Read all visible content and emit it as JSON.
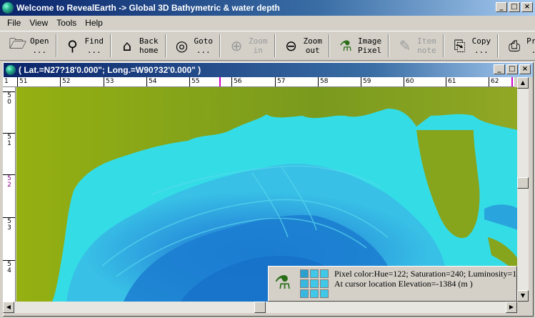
{
  "window": {
    "title": "Welcome to RevealEarth -> Global 3D Bathymetric &  water depth"
  },
  "menu": [
    "File",
    "View",
    "Tools",
    "Help"
  ],
  "toolbar": [
    {
      "icon": "open-icon",
      "label": "Open\n...",
      "enabled": true
    },
    {
      "icon": "binoculars-icon",
      "label": "Find\n...",
      "enabled": true
    },
    {
      "icon": "back-home-icon",
      "label": "Back\nhome",
      "enabled": true
    },
    {
      "icon": "compass-icon",
      "label": "Goto\n...",
      "enabled": true
    },
    {
      "icon": "zoom-in-icon",
      "label": "Zoom\nin",
      "enabled": false
    },
    {
      "icon": "zoom-out-icon",
      "label": "Zoom\nout",
      "enabled": true
    },
    {
      "icon": "microscope-icon",
      "label": "Image\nPixel",
      "enabled": true
    },
    {
      "icon": "item-note-icon",
      "label": "Item\nnote",
      "enabled": false
    },
    {
      "icon": "copy-icon",
      "label": "Copy\n...",
      "enabled": true
    },
    {
      "icon": "printer-icon",
      "label": "Print\n...",
      "enabled": true
    }
  ],
  "child_window": {
    "title": "( Lat.=N27?18'0.000\"; Long.=W90?32'0.000\" )"
  },
  "ruler_top": {
    "corner": "1",
    "labels": [
      "51",
      "52",
      "53",
      "54",
      "55",
      "56",
      "57",
      "58",
      "59",
      "60",
      "61",
      "62"
    ]
  },
  "ruler_left": {
    "labels": [
      "5\n0",
      "5\n1",
      "5\n2",
      "5\n3",
      "5\n4"
    ]
  },
  "info": {
    "pixel_color": "Pixel color:Hue=122;  Saturation=240;  Luminosity=1",
    "elevation": "At cursor location Elevation=-1384 (m )"
  },
  "colors": {
    "land": "#8aa81a",
    "shelf": "#30e0e8",
    "deep": "#1a8ad8",
    "swatch": [
      "#2aa0d0",
      "#40c8e8",
      "#40c8e8",
      "#38b8e0",
      "#40c8e8",
      "#40c8e8",
      "#38b8e0",
      "#40c8e8",
      "#40c8e8"
    ]
  }
}
